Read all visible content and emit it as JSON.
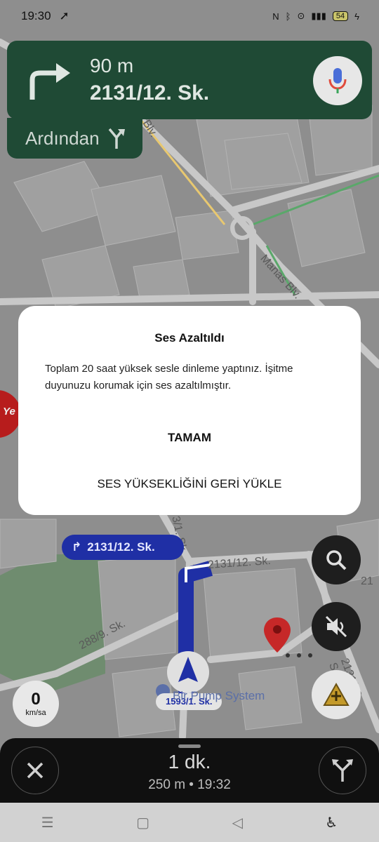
{
  "status_bar": {
    "time": "19:30",
    "battery": "54"
  },
  "navigation": {
    "distance": "90 m",
    "street": "2131/12. Sk.",
    "then_label": "Ardından"
  },
  "map": {
    "route_chip": "2131/12. Sk.",
    "labels": {
      "manas": "Manas Blv.",
      "blv": "Blv.",
      "street_a": "2131/12. Sk.",
      "street_b": "288/9. Sk.",
      "street_c": "2131/18. S",
      "street_d": "3/1. Sk.",
      "street_e": "21",
      "current_street": "1593/1. Sk.",
      "poi": "Bir Pump System",
      "edge_poi": "Ye"
    }
  },
  "speed": {
    "value": "0",
    "unit": "km/sa"
  },
  "dialog": {
    "title": "Ses Azaltıldı",
    "body": "Toplam 20 saat yüksek sesle dinleme yaptınız. İşitme duyunuzu korumak için ses azaltılmıştır.",
    "ok_button": "TAMAM",
    "restore_button": "SES YÜKSEKLİĞİNİ GERİ YÜKLE"
  },
  "trip": {
    "eta_duration": "1 dk.",
    "eta_detail": "250 m  •  19:32"
  },
  "colors": {
    "nav_green": "#1f4a35",
    "route_blue": "#1f2fa5",
    "pin_red": "#c62828"
  }
}
